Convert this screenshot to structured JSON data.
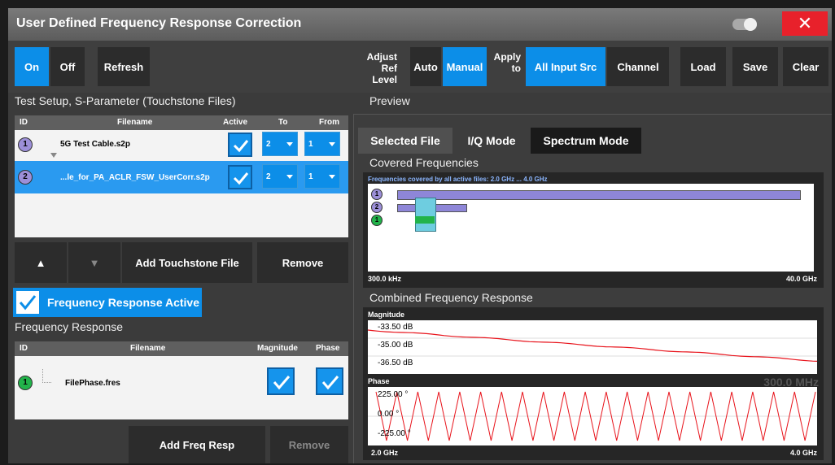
{
  "window": {
    "title": "User Defined Frequency Response Correction",
    "close_label": "✕"
  },
  "toolbar": {
    "on_label": "On",
    "off_label": "Off",
    "refresh_label": "Refresh",
    "adjust_ref_label_1": "Adjust",
    "adjust_ref_label_2": "Ref Level",
    "auto_label": "Auto",
    "manual_label": "Manual",
    "apply_label_1": "Apply",
    "apply_label_2": "to",
    "all_input_label": "All Input Src",
    "channel_label": "Channel",
    "load_label": "Load",
    "save_label": "Save",
    "clear_label": "Clear"
  },
  "test_setup": {
    "title": "Test Setup, S-Parameter (Touchstone Files)",
    "columns": [
      "ID",
      "Filename",
      "Active",
      "To",
      "From"
    ],
    "rows": [
      {
        "id": "1",
        "filename": "5G Test Cable.s2p",
        "to": "2",
        "from": "1"
      },
      {
        "id": "2",
        "filename": "...le_for_PA_ACLR_FSW_UserCorr.s2p",
        "to": "2",
        "from": "1"
      }
    ],
    "up_label": "▲",
    "down_label": "▼",
    "add_label": "Add Touchstone File",
    "remove_label": "Remove"
  },
  "freq_resp_active": {
    "label": "Frequency Response Active"
  },
  "freq_response": {
    "title": "Frequency Response",
    "columns": [
      "ID",
      "Filename",
      "Magnitude",
      "Phase"
    ],
    "rows": [
      {
        "id": "1",
        "filename": "FilePhase.fres"
      }
    ],
    "add_label": "Add Freq Resp",
    "remove_label": "Remove"
  },
  "preview": {
    "title": "Preview",
    "tabs": [
      "Selected File",
      "I/Q Mode",
      "Spectrum Mode"
    ],
    "covered": {
      "title": "Covered Frequencies",
      "caption": "Frequencies covered by all active files: 2.0 GHz ... 4.0 GHz",
      "start": "300.0 kHz",
      "stop": "40.0 GHz",
      "markers": [
        "1",
        "2",
        "1"
      ]
    },
    "combined": {
      "title": "Combined Frequency Response",
      "magnitude_label": "Magnitude",
      "mag_ticks": [
        "-33.50 dB",
        "-35.00 dB",
        "-36.50 dB"
      ],
      "phase_label": "Phase",
      "phase_ticks": [
        "225.00 °",
        "0.00 °",
        "-225.00 °"
      ],
      "start": "2.0 GHz",
      "stop": "4.0 GHz",
      "ghost_1": "300.0 MHz"
    }
  },
  "colors": {
    "accent": "#0c8ee8",
    "close": "#e8212b",
    "trace": "#e8131b",
    "bar": "#8e86d8"
  }
}
